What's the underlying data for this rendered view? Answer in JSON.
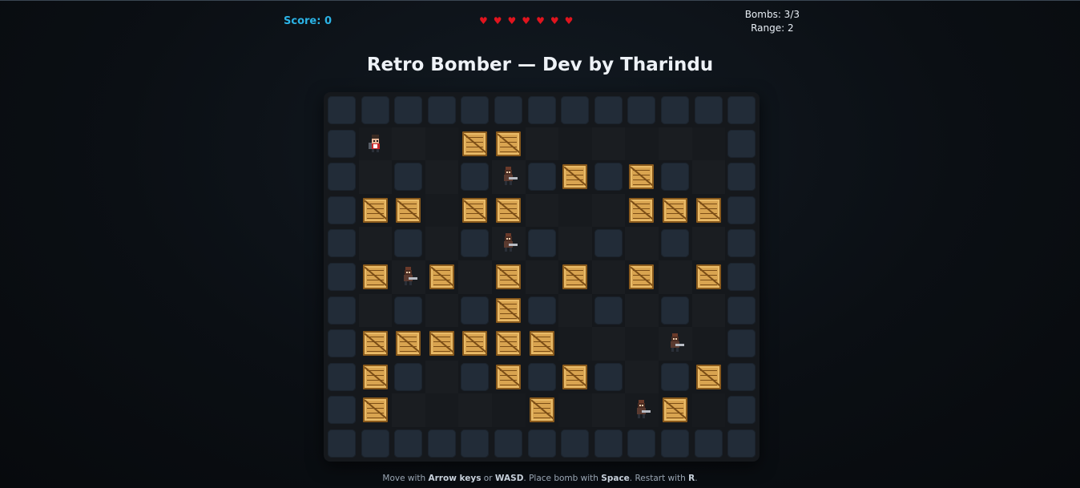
{
  "hud": {
    "score_label": "Score:",
    "score_value": "0",
    "lives": 7,
    "bombs_text": "Bombs: 3/3",
    "range_text": "Range: 2"
  },
  "title": "Retro Bomber — Dev by Tharindu",
  "footer": {
    "t1": "Move with ",
    "k1": "Arrow keys",
    "t2": " or ",
    "k2": "WASD",
    "t3": ". Place bomb with ",
    "k3": "Space",
    "t4": ". Restart with ",
    "k4": "R",
    "t5": "."
  },
  "board": {
    "cols": 13,
    "rows": 11,
    "crates": [
      [
        1,
        4
      ],
      [
        1,
        5
      ],
      [
        2,
        7
      ],
      [
        2,
        9
      ],
      [
        3,
        1
      ],
      [
        3,
        2
      ],
      [
        3,
        4
      ],
      [
        3,
        5
      ],
      [
        3,
        9
      ],
      [
        3,
        10
      ],
      [
        3,
        11
      ],
      [
        5,
        1
      ],
      [
        5,
        3
      ],
      [
        5,
        5
      ],
      [
        5,
        7
      ],
      [
        5,
        9
      ],
      [
        5,
        11
      ],
      [
        6,
        5
      ],
      [
        7,
        1
      ],
      [
        7,
        2
      ],
      [
        7,
        3
      ],
      [
        7,
        4
      ],
      [
        7,
        5
      ],
      [
        7,
        6
      ],
      [
        8,
        1
      ],
      [
        8,
        5
      ],
      [
        8,
        7
      ],
      [
        8,
        11
      ],
      [
        9,
        1
      ],
      [
        9,
        6
      ],
      [
        9,
        10
      ]
    ],
    "player": [
      1,
      1
    ],
    "enemies": [
      [
        2,
        5
      ],
      [
        4,
        5
      ],
      [
        5,
        2
      ],
      [
        7,
        10
      ],
      [
        9,
        9
      ]
    ]
  },
  "colors": {
    "accent": "#2bb3e6",
    "heart": "#e0141e",
    "wall": "#222c38",
    "crate": "#d9a450"
  }
}
